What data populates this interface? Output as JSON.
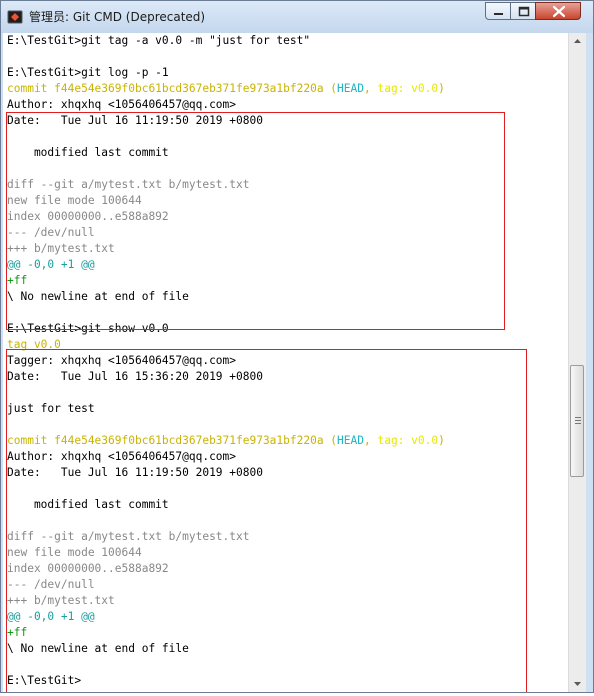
{
  "window": {
    "title": "管理员: Git CMD (Deprecated)",
    "icons": {
      "app": "git-cmd-icon",
      "minimize": "minimize-icon",
      "maximize": "maximize-icon",
      "close": "close-icon"
    }
  },
  "colors": {
    "yellow": "#c8b400",
    "cyan": "#1ab7c8",
    "bright_yellow": "#e8e800",
    "gray": "#888888",
    "green": "#119911",
    "teal": "#1a9e9e",
    "annotation_red": "#e02020"
  },
  "console": {
    "lines": [
      {
        "segments": [
          {
            "text": "E:\\TestGit>git tag -a v0.0 -m \"just for test\"",
            "color": "dark"
          }
        ]
      },
      {
        "segments": [
          {
            "text": "",
            "color": "dark"
          }
        ]
      },
      {
        "segments": [
          {
            "text": "E:\\TestGit>git log -p -1",
            "color": "dark"
          }
        ]
      },
      {
        "segments": [
          {
            "text": "commit f44e54e369f0bc61bcd367eb371fe973a1bf220a (",
            "color": "yellow"
          },
          {
            "text": "HEAD",
            "color": "cyan"
          },
          {
            "text": ", ",
            "color": "yellow"
          },
          {
            "text": "tag: v0.0",
            "color": "bright_yellow"
          },
          {
            "text": ")",
            "color": "yellow"
          }
        ]
      },
      {
        "segments": [
          {
            "text": "Author: xhqxhq <1056406457@qq.com>",
            "color": "dark"
          }
        ]
      },
      {
        "segments": [
          {
            "text": "Date:   Tue Jul 16 11:19:50 2019 +0800",
            "color": "dark"
          }
        ]
      },
      {
        "segments": [
          {
            "text": "",
            "color": "dark"
          }
        ]
      },
      {
        "segments": [
          {
            "text": "    modified last commit",
            "color": "dark"
          }
        ]
      },
      {
        "segments": [
          {
            "text": "",
            "color": "dark"
          }
        ]
      },
      {
        "segments": [
          {
            "text": "diff --git a/mytest.txt b/mytest.txt",
            "color": "gray"
          }
        ]
      },
      {
        "segments": [
          {
            "text": "new file mode 100644",
            "color": "gray"
          }
        ]
      },
      {
        "segments": [
          {
            "text": "index 00000000..e588a892",
            "color": "gray"
          }
        ]
      },
      {
        "segments": [
          {
            "text": "--- /dev/null",
            "color": "gray"
          }
        ]
      },
      {
        "segments": [
          {
            "text": "+++ b/mytest.txt",
            "color": "gray"
          }
        ]
      },
      {
        "segments": [
          {
            "text": "@@ -0,0 +1 @@",
            "color": "teal"
          }
        ]
      },
      {
        "segments": [
          {
            "text": "+ff",
            "color": "green"
          }
        ]
      },
      {
        "segments": [
          {
            "text": "\\ No newline at end of file",
            "color": "dark"
          }
        ]
      },
      {
        "segments": [
          {
            "text": "",
            "color": "dark"
          }
        ]
      },
      {
        "segments": [
          {
            "text": "E:\\TestGit>git show v0.0",
            "color": "dark"
          }
        ]
      },
      {
        "segments": [
          {
            "text": "tag v0.0",
            "color": "yellow"
          }
        ]
      },
      {
        "segments": [
          {
            "text": "Tagger: xhqxhq <1056406457@qq.com>",
            "color": "dark"
          }
        ]
      },
      {
        "segments": [
          {
            "text": "Date:   Tue Jul 16 15:36:20 2019 +0800",
            "color": "dark"
          }
        ]
      },
      {
        "segments": [
          {
            "text": "",
            "color": "dark"
          }
        ]
      },
      {
        "segments": [
          {
            "text": "just for test",
            "color": "dark"
          }
        ]
      },
      {
        "segments": [
          {
            "text": "",
            "color": "dark"
          }
        ]
      },
      {
        "segments": [
          {
            "text": "commit f44e54e369f0bc61bcd367eb371fe973a1bf220a (",
            "color": "yellow"
          },
          {
            "text": "HEAD",
            "color": "cyan"
          },
          {
            "text": ", ",
            "color": "yellow"
          },
          {
            "text": "tag: v0.0",
            "color": "bright_yellow"
          },
          {
            "text": ")",
            "color": "yellow"
          }
        ]
      },
      {
        "segments": [
          {
            "text": "Author: xhqxhq <1056406457@qq.com>",
            "color": "dark"
          }
        ]
      },
      {
        "segments": [
          {
            "text": "Date:   Tue Jul 16 11:19:50 2019 +0800",
            "color": "dark"
          }
        ]
      },
      {
        "segments": [
          {
            "text": "",
            "color": "dark"
          }
        ]
      },
      {
        "segments": [
          {
            "text": "    modified last commit",
            "color": "dark"
          }
        ]
      },
      {
        "segments": [
          {
            "text": "",
            "color": "dark"
          }
        ]
      },
      {
        "segments": [
          {
            "text": "diff --git a/mytest.txt b/mytest.txt",
            "color": "gray"
          }
        ]
      },
      {
        "segments": [
          {
            "text": "new file mode 100644",
            "color": "gray"
          }
        ]
      },
      {
        "segments": [
          {
            "text": "index 00000000..e588a892",
            "color": "gray"
          }
        ]
      },
      {
        "segments": [
          {
            "text": "--- /dev/null",
            "color": "gray"
          }
        ]
      },
      {
        "segments": [
          {
            "text": "+++ b/mytest.txt",
            "color": "gray"
          }
        ]
      },
      {
        "segments": [
          {
            "text": "@@ -0,0 +1 @@",
            "color": "teal"
          }
        ]
      },
      {
        "segments": [
          {
            "text": "+ff",
            "color": "green"
          }
        ]
      },
      {
        "segments": [
          {
            "text": "\\ No newline at end of file",
            "color": "dark"
          }
        ]
      },
      {
        "segments": [
          {
            "text": "",
            "color": "dark"
          }
        ]
      },
      {
        "segments": [
          {
            "text": "E:\\TestGit>",
            "color": "dark"
          }
        ]
      }
    ]
  },
  "scrollbar": {
    "up_icon": "scroll-up-arrow-icon",
    "down_icon": "scroll-down-arrow-icon"
  }
}
